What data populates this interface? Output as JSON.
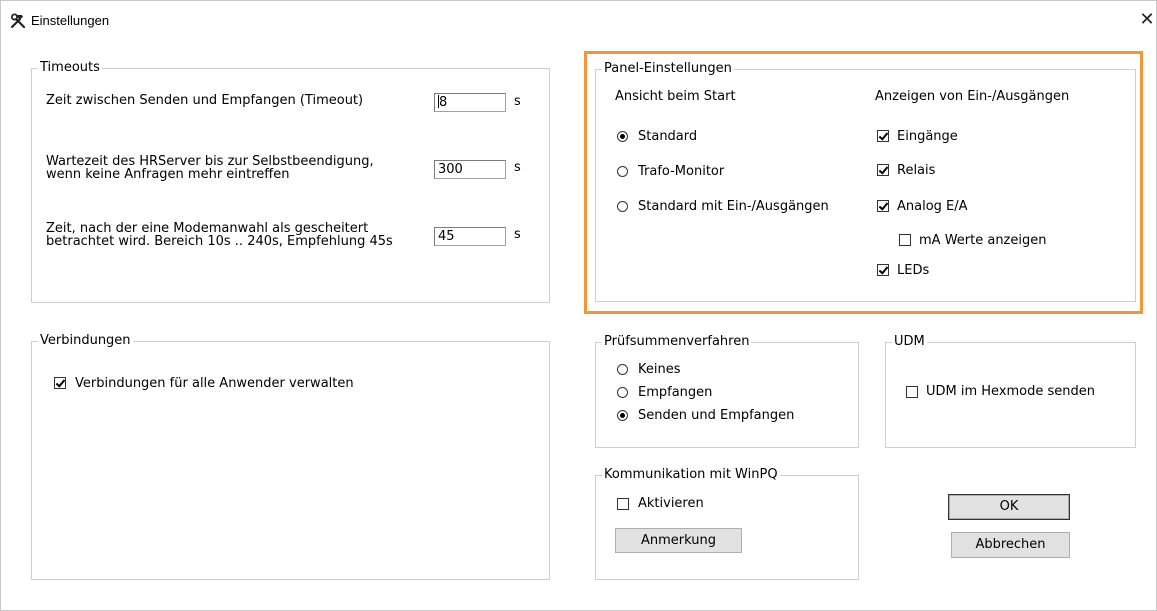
{
  "window": {
    "title": "Einstellungen",
    "close_symbol": "✕"
  },
  "timeouts": {
    "legend": "Timeouts",
    "rows": [
      {
        "label": "Zeit zwischen Senden und Empfangen (Timeout)",
        "value": "8",
        "unit": "s"
      },
      {
        "label": "Wartezeit des HRServer bis zur Selbstbeendigung, wenn keine Anfragen mehr eintreffen",
        "value": "300",
        "unit": "s"
      },
      {
        "label": "Zeit, nach der eine Modemanwahl als gescheitert betrachtet wird. Bereich 10s .. 240s, Empfehlung 45s",
        "value": "45",
        "unit": "s"
      }
    ]
  },
  "panel": {
    "legend": "Panel-Einstellungen",
    "start_view": {
      "heading": "Ansicht beim Start",
      "options": [
        {
          "label": "Standard",
          "selected": true
        },
        {
          "label": "Trafo-Monitor",
          "selected": false
        },
        {
          "label": "Standard mit Ein-/Ausgängen",
          "selected": false
        }
      ]
    },
    "io_display": {
      "heading": "Anzeigen von Ein-/Ausgängen",
      "options": [
        {
          "label": "Eingänge",
          "checked": true
        },
        {
          "label": "Relais",
          "checked": true
        },
        {
          "label": "Analog E/A",
          "checked": true
        },
        {
          "label": "mA Werte anzeigen",
          "checked": false
        },
        {
          "label": "LEDs",
          "checked": true
        }
      ]
    },
    "highlight_color": "#f0963c"
  },
  "connections": {
    "legend": "Verbindungen",
    "manage_all": {
      "label": "Verbindungen für alle Anwender verwalten",
      "checked": true
    }
  },
  "checksum": {
    "legend": "Prüfsummenverfahren",
    "options": [
      {
        "label": "Keines",
        "selected": false
      },
      {
        "label": "Empfangen",
        "selected": false
      },
      {
        "label": "Senden und Empfangen",
        "selected": true
      }
    ]
  },
  "udm": {
    "legend": "UDM",
    "hexmode": {
      "label": "UDM im Hexmode senden",
      "checked": false
    }
  },
  "winpq": {
    "legend": "Kommunikation mit WinPQ",
    "activate": {
      "label": "Aktivieren",
      "checked": false
    },
    "note_button": "Anmerkung"
  },
  "buttons": {
    "ok": "OK",
    "cancel": "Abbrechen"
  },
  "icons": {
    "title_icon": "hammer-wrench-icon",
    "close": "close-icon"
  }
}
